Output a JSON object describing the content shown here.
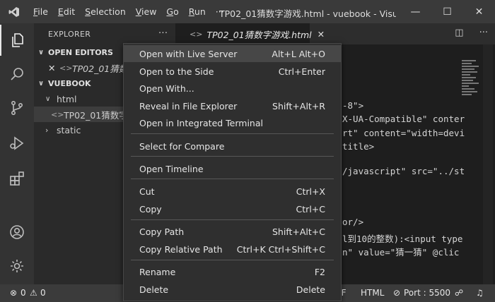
{
  "titlebar": {
    "menu": [
      "File",
      "Edit",
      "Selection",
      "View",
      "Go",
      "Run",
      "···"
    ],
    "menu_mnemonic": [
      "F",
      "E",
      "S",
      "V",
      "G",
      "R",
      ""
    ],
    "window_title": "TP02_01猜数字游戏.html - vuebook - Visu...",
    "win_min": "—",
    "win_max": "☐",
    "win_close": "✕"
  },
  "sidebar": {
    "header": "EXPLORER",
    "more": "···",
    "open_editors_label": "OPEN EDITORS",
    "open_editor_file": "TP02_01猜数",
    "vuebook_label": "VUEBOOK",
    "folder_html": "html",
    "file_html": "TP02_01猜数字",
    "folder_static": "static"
  },
  "tab": {
    "label": "TP02_01猜数字游戏.html",
    "close": "✕"
  },
  "code_lines": [
    "-8\">",
    "X-UA-Compatible\" conter",
    "rt\" content=\"width=devi",
    "title>",
    "/javascript\" src=\"../st",
    "or/>",
    "l到10的整数):<input type",
    "n\" value=\"猜一猜\" @clic"
  ],
  "context_menu": [
    {
      "label": "Open with Live Server",
      "shortcut": "Alt+L Alt+O"
    },
    {
      "label": "Open to the Side",
      "shortcut": "Ctrl+Enter"
    },
    {
      "label": "Open With...",
      "shortcut": ""
    },
    {
      "label": "Reveal in File Explorer",
      "shortcut": "Shift+Alt+R"
    },
    {
      "label": "Open in Integrated Terminal",
      "shortcut": ""
    },
    {
      "label": "Select for Compare",
      "shortcut": ""
    },
    {
      "label": "Open Timeline",
      "shortcut": ""
    },
    {
      "label": "Cut",
      "shortcut": "Ctrl+X"
    },
    {
      "label": "Copy",
      "shortcut": "Ctrl+C"
    },
    {
      "label": "Copy Path",
      "shortcut": "Shift+Alt+C"
    },
    {
      "label": "Copy Relative Path",
      "shortcut": "Ctrl+K Ctrl+Shift+C"
    },
    {
      "label": "Rename",
      "shortcut": "F2"
    },
    {
      "label": "Delete",
      "shortcut": "Delete"
    }
  ],
  "statusbar": {
    "errors": "0",
    "warnings": "0",
    "eol": "LF",
    "language": "HTML",
    "port": "Port : 5500"
  }
}
